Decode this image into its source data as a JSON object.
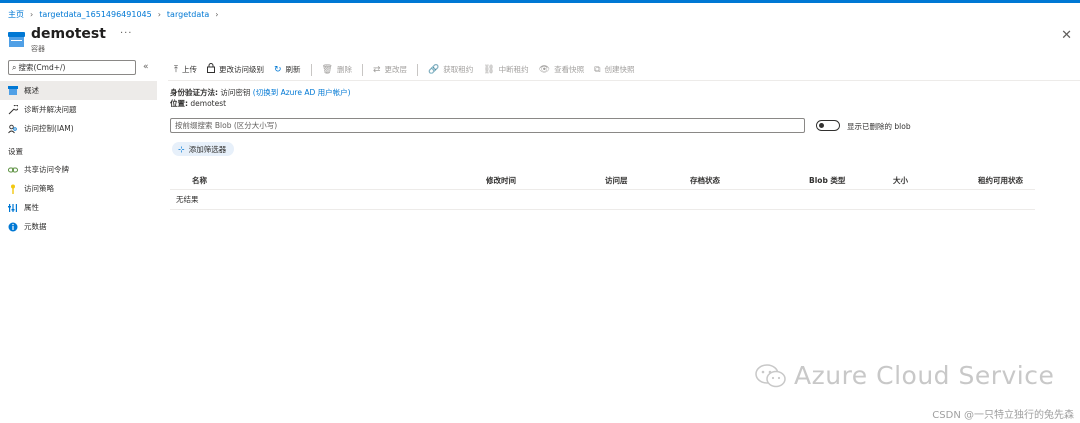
{
  "breadcrumb": {
    "home": "主页",
    "item1": "targetdata_1651496491045",
    "item2": "targetdata"
  },
  "header": {
    "title": "demotest",
    "subtitle": "容器",
    "more": "···",
    "close": "✕"
  },
  "sidebar": {
    "search_placeholder": "搜索(Cmd+/)",
    "collapse": "«",
    "items": [
      {
        "label": "概述",
        "icon": "container-icon"
      },
      {
        "label": "诊断并解决问题",
        "icon": "wrench-icon"
      },
      {
        "label": "访问控制(IAM)",
        "icon": "people-icon"
      }
    ],
    "section_settings": "设置",
    "settings_items": [
      {
        "label": "共享访问令牌",
        "icon": "link-icon"
      },
      {
        "label": "访问策略",
        "icon": "key-icon"
      },
      {
        "label": "属性",
        "icon": "properties-icon"
      },
      {
        "label": "元数据",
        "icon": "info-icon"
      }
    ]
  },
  "toolbar": {
    "upload": "上传",
    "change_access": "更改访问级别",
    "refresh": "刷新",
    "delete": "删除",
    "change_tier": "更改层",
    "acquire_lease": "获取租约",
    "break_lease": "中断租约",
    "view_snapshots": "查看快照",
    "create_snapshot": "创建快照"
  },
  "info": {
    "auth_label": "身份验证方法:",
    "auth_value": "访问密钥",
    "auth_link": "(切换到 Azure AD 用户帐户)",
    "location_label": "位置:",
    "location_value": "demotest"
  },
  "blob_search": {
    "placeholder": "按前缀搜索 Blob (区分大小写)"
  },
  "toggle": {
    "label": "显示已删除的 blob"
  },
  "filter": {
    "label": "添加筛选器"
  },
  "table": {
    "columns": [
      "名称",
      "修改时间",
      "访问层",
      "存档状态",
      "Blob 类型",
      "大小",
      "租约可用状态"
    ],
    "empty": "无结果"
  },
  "watermark": {
    "text": "Azure Cloud Service",
    "csdn": "CSDN @一只特立独行的兔先森"
  }
}
